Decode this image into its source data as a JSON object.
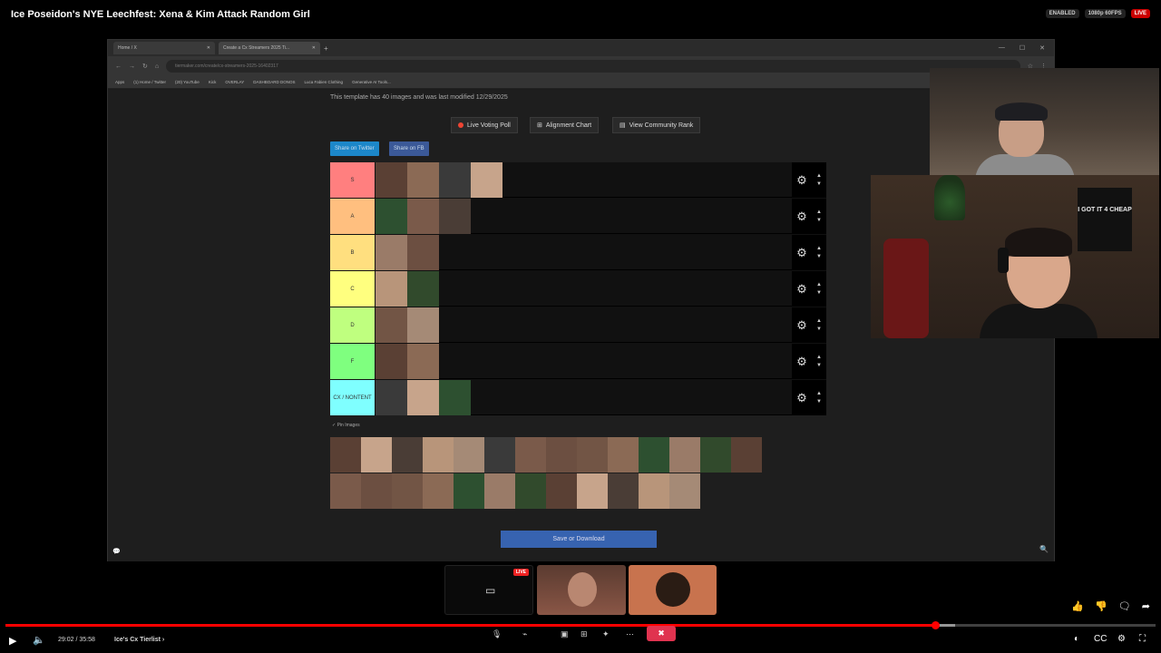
{
  "video": {
    "title": "Ice Poseidon's NYE Leechfest: Xena & Kim Attack Random Girl",
    "badges": [
      "ENABLED",
      "1080p 60FPS",
      "LIVE"
    ],
    "time": "29:02 / 35:58",
    "chapter": "Ice's Cx Tierlist",
    "progress_fraction": 0.808
  },
  "browser": {
    "tabs": [
      {
        "label": "Home / X"
      },
      {
        "label": "Create a Cx Streamers 2025 Ti..."
      }
    ],
    "url": "tiermaker.com/create/cx-streamers-2025-16402317",
    "bookmarks": [
      "Apps",
      "(1) Home / Twitter",
      "(20) YouTube",
      "Kick",
      "OVERLAY",
      "DASHBOARD DONOS",
      "Luca Fabien Clothing",
      "Generative AI Tools..."
    ]
  },
  "page": {
    "template_info": "This template has 40 images and was last modified 12/29/2025",
    "buttons": {
      "voting": "Live Voting Poll",
      "alignment": "Alignment Chart",
      "community": "View Community Rank"
    },
    "share": {
      "twitter": "Share on Twitter",
      "fb": "Share on FB"
    },
    "tiers": [
      {
        "label": "S",
        "color": "#ff7f7f",
        "count": 4
      },
      {
        "label": "A",
        "color": "#ffbf7f",
        "count": 3
      },
      {
        "label": "B",
        "color": "#ffdf7f",
        "count": 2
      },
      {
        "label": "C",
        "color": "#ffff7f",
        "count": 2
      },
      {
        "label": "D",
        "color": "#bfff7f",
        "count": 2
      },
      {
        "label": "F",
        "color": "#7fff7f",
        "count": 2
      },
      {
        "label": "CX / NONTENT",
        "color": "#7fffff",
        "count": 3
      }
    ],
    "pin_label": "Pin Images",
    "save_label": "Save or Download"
  },
  "shirt_text": "I GOT IT 4 CHEAP",
  "colors": {
    "accent_red": "#ff0000",
    "save_blue": "#3763b0",
    "twitter_blue": "#1c87c9",
    "fb_blue": "#3b5998"
  }
}
